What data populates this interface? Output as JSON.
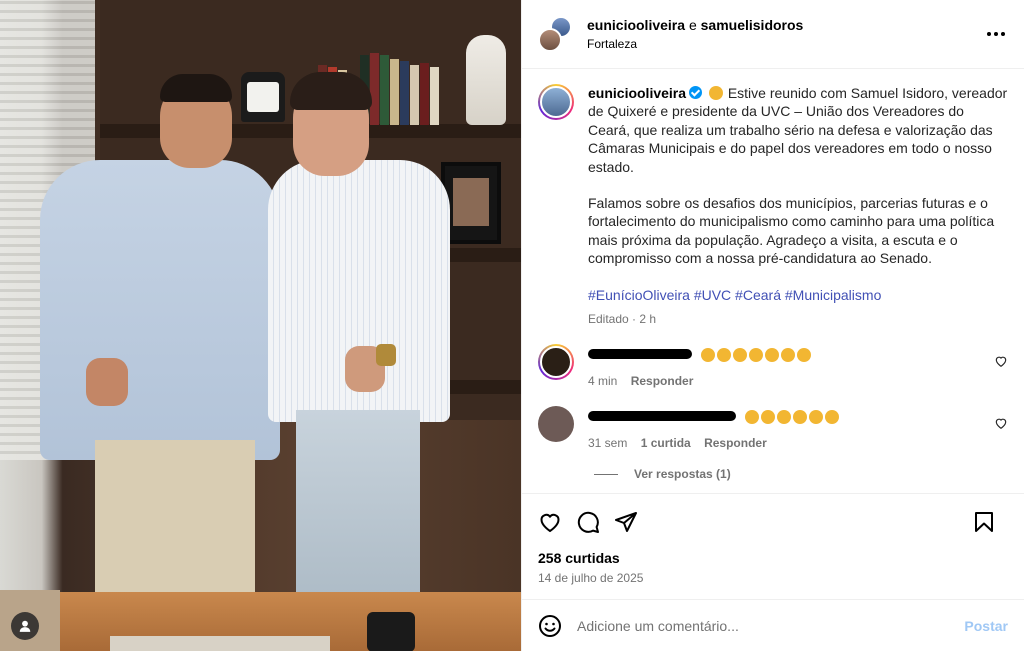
{
  "header": {
    "user1": "eunicioolivera_placeholder",
    "connector": "e",
    "user2": "samuelisidoros",
    "location": "Fortaleza"
  },
  "caption": {
    "username": "eunicioolivera_placeholder",
    "text1": "Estive reunido com Samuel Isidoro, vereador de Quixeré e presidente da UVC – União dos Vereadores do Ceará, que realiza um trabalho sério na defesa e valorização das Câmaras Municipais e do papel dos vereadores em todo o nosso estado.",
    "text2": "Falamos sobre os desafios dos municípios, parcerias futuras e o fortalecimento do municipalismo como caminho para uma política mais próxima da população. Agradeço a visita, a escuta e o compromisso com a nossa pré-candidatura ao Senado.",
    "hashtags": "#EunícioOliveira #UVC #Ceará #Municipalismo",
    "meta": "Editado · 2 h"
  },
  "comments": [
    {
      "time": "4 min",
      "reply_label": "Responder",
      "likes": ""
    },
    {
      "time": "31 sem",
      "likes": "1 curtida",
      "reply_label": "Responder"
    }
  ],
  "view_replies": "Ver respostas (1)",
  "likes_text": "258 curtidas",
  "date_text": "14 de julho de 2025",
  "comment_input": {
    "placeholder": "Adicione um comentário...",
    "post_label": "Postar"
  },
  "colors": {
    "link": "#4150b5",
    "verified": "#0095f6",
    "post_button": "#a0c8f5"
  }
}
